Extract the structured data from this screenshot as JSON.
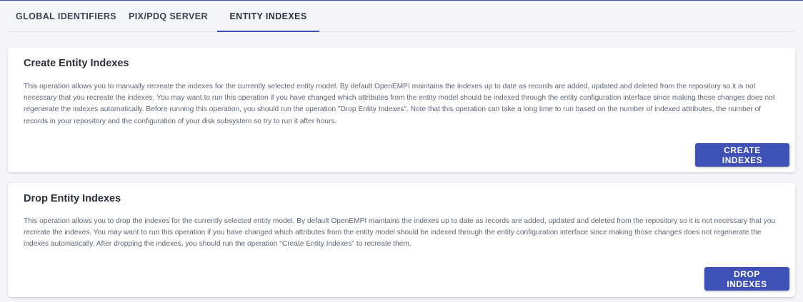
{
  "tabs": [
    {
      "label": "GLOBAL IDENTIFIERS"
    },
    {
      "label": "PIX/PDQ SERVER"
    },
    {
      "label": "ENTITY INDEXES"
    }
  ],
  "active_tab": "ENTITY INDEXES",
  "accent_color": "#3f51b5",
  "cards": [
    {
      "title": "Create Entity Indexes",
      "text": "This operation allows you to manually recreate the indexes for the currently selected entity model. By default OpenEMPI maintains the indexes up to date as records are added, updated and deleted from the repository so it is not necessary that you recreate the indexes. You may want to run this operation if you have changed which attributes from the entity model should be indexed through the entity configuration interface since making those changes does not regenerate the indexes automatically. Before running this operation, you should run the operation \"Drop Entity Indexes\". Note that this operation can take a long time to run based on the number of indexed attributes, the number of records in your repository and the configuration of your disk subsystem so try to run it after hours.",
      "button": "CREATE INDEXES"
    },
    {
      "title": "Drop Entity Indexes",
      "text": "This operation allows you to drop the indexes for the currently selected entity model. By default OpenEMPI maintains the indexes up to date as records are added, updated and deleted from the repository so it is not necessary that you recreate the indexes. You may want to run this operation if you have changed which attributes from the entity model should be indexed through the entity configuration interface since making those changes does not regenerate the indexes automatically. After dropping the indexes, you should run the operation \"Create Entity Indexes\" to recreate them.",
      "button": "DROP INDEXES"
    }
  ]
}
